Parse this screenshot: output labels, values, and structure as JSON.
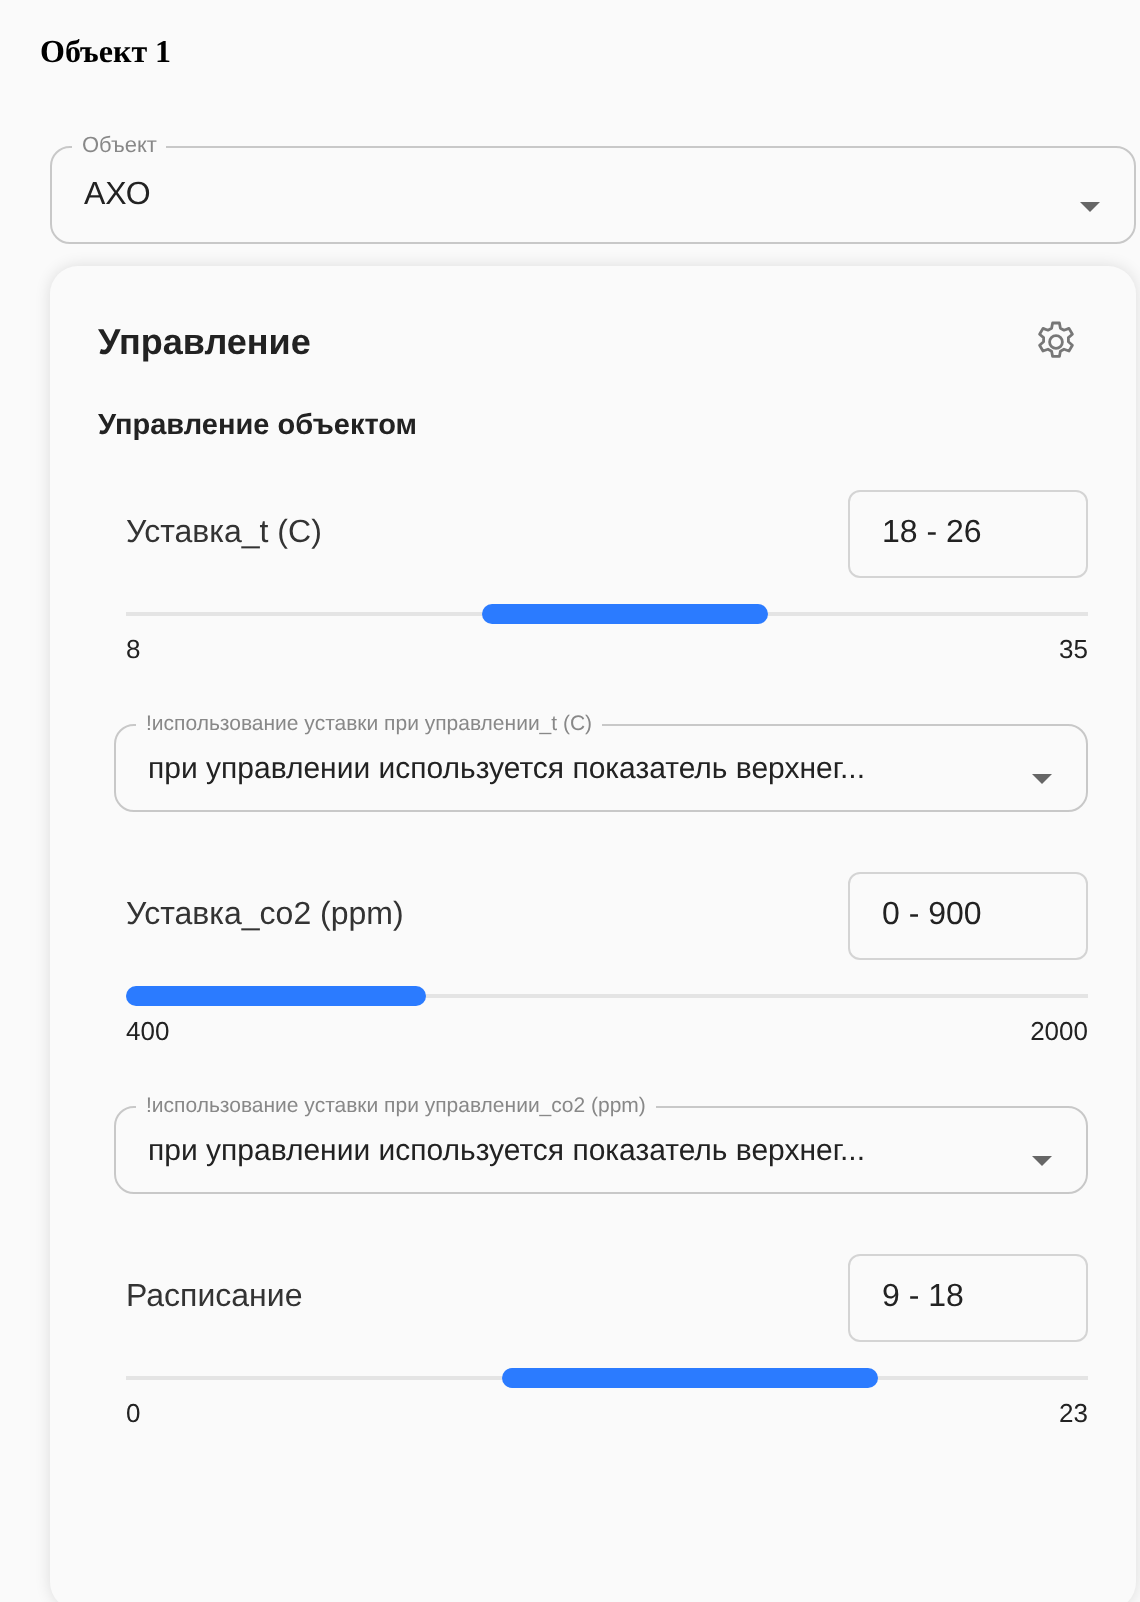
{
  "page_title": "Объект 1",
  "object_select": {
    "label": "Объект",
    "value": "АХО"
  },
  "card": {
    "title": "Управление",
    "subtitle": "Управление объектом",
    "controls": [
      {
        "kind": "range",
        "label": "Уставка_t (C)",
        "value": "18 - 26",
        "min": "8",
        "max": "35"
      },
      {
        "kind": "select",
        "label": "!использование уставки при управлении_t (C)",
        "value": "при управлении используется показатель верхнег..."
      },
      {
        "kind": "range",
        "label": "Уставка_co2 (ppm)",
        "value": "0 - 900",
        "min": "400",
        "max": "2000"
      },
      {
        "kind": "select",
        "label": "!использование уставки при управлении_co2 (ppm)",
        "value": "при управлении используется показатель верхнег..."
      },
      {
        "kind": "range",
        "label": "Расписание",
        "value": "9 - 18",
        "min": "0",
        "max": "23"
      }
    ]
  }
}
